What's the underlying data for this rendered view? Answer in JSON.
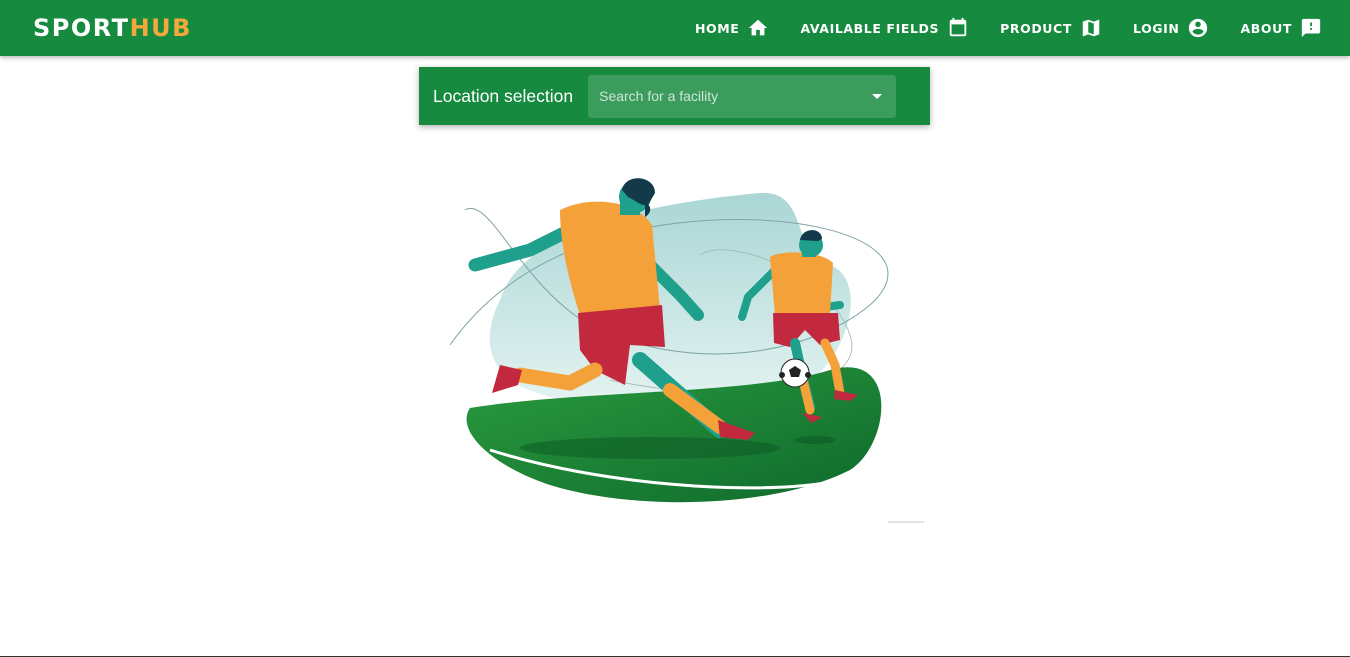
{
  "brand": {
    "part1": "SPORT",
    "part2": "HUB"
  },
  "nav": {
    "items": [
      {
        "label": "HOME",
        "icon": "home-icon"
      },
      {
        "label": "AVAILABLE FIELDS",
        "icon": "calendar-icon"
      },
      {
        "label": "PRODUCT",
        "icon": "map-icon"
      },
      {
        "label": "LOGIN",
        "icon": "account-circle-icon"
      },
      {
        "label": "ABOUT",
        "icon": "feedback-icon"
      }
    ]
  },
  "location": {
    "title": "Location selection",
    "select_placeholder": "Search for a facility"
  },
  "colors": {
    "primary": "#168a3f",
    "accent": "#f2a83b",
    "text_on_primary": "#ffffff"
  }
}
